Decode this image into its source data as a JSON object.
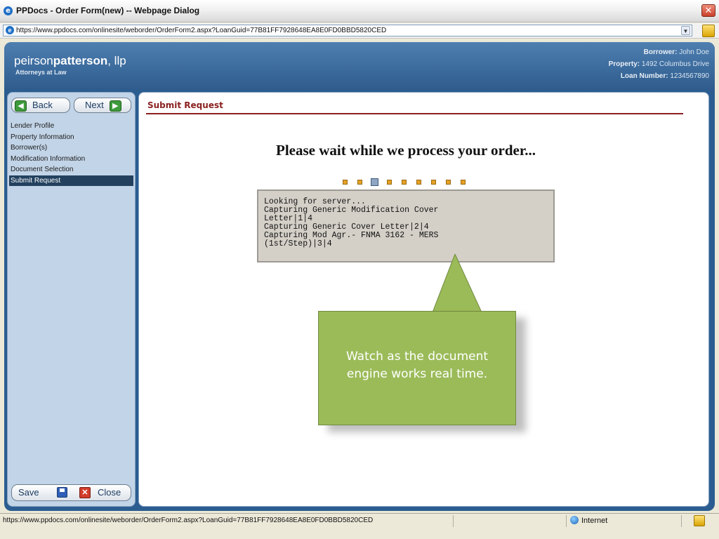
{
  "window": {
    "title": "PPDocs - Order Form(new) -- Webpage Dialog",
    "close_label": "✕"
  },
  "address": {
    "url": "https://www.ppdocs.com/onlinesite/weborder/OrderForm2.aspx?LoanGuid=77B81FF7928648EA8E0FD0BBD5820CED"
  },
  "header": {
    "logo_light": "peirson",
    "logo_bold": "patterson",
    "logo_suffix": ", llp",
    "logo_sub": "Attorneys at Law",
    "borrower_label": "Borrower:",
    "borrower_value": "John Doe",
    "property_label": "Property:",
    "property_value": "1492 Columbus Drive",
    "loan_label": "Loan Number:",
    "loan_value": "1234567890"
  },
  "sidebar": {
    "back_label": "Back",
    "next_label": "Next",
    "items": [
      {
        "label": "Lender Profile"
      },
      {
        "label": "Property Information"
      },
      {
        "label": "Borrower(s)"
      },
      {
        "label": "Modification Information"
      },
      {
        "label": "Document Selection"
      },
      {
        "label": "Submit Request"
      }
    ],
    "active_index": 5,
    "save_label": "Save",
    "close_label": "Close"
  },
  "content": {
    "section_title": "Submit Request",
    "wait_message": "Please wait while we process your order...",
    "progress": {
      "dots": 9,
      "current_index": 2
    },
    "log_text": "Looking for server...\nCapturing Generic Modification Cover\nLetter|1|4\nCapturing Generic Cover Letter|2|4\nCapturing Mod Agr.- FNMA 3162 - MERS\n(1st/Step)|3|4"
  },
  "callout": {
    "text_line1": "Watch as the document",
    "text_line2": "engine works real time.",
    "color": "#9bbb59"
  },
  "status": {
    "url": "https://www.ppdocs.com/onlinesite/weborder/OrderForm2.aspx?LoanGuid=77B81FF7928648EA8E0FD0BBD5820CED",
    "zone": "Internet"
  }
}
